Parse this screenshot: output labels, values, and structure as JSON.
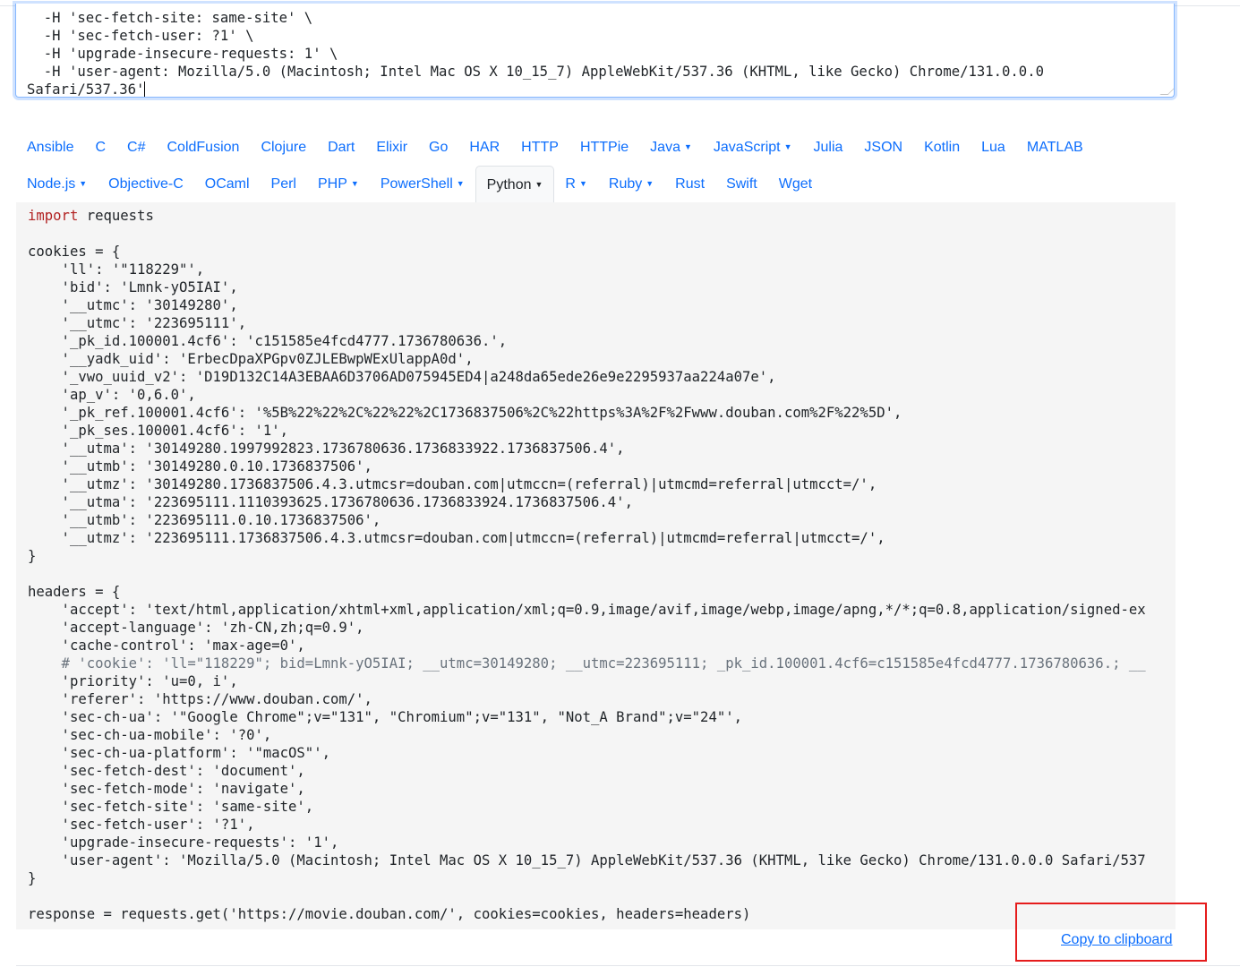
{
  "curl_input": {
    "lines": [
      "  -H 'sec-fetch-site: same-site' \\",
      "  -H 'sec-fetch-user: ?1' \\",
      "  -H 'upgrade-insecure-requests: 1' \\",
      "  -H 'user-agent: Mozilla/5.0 (Macintosh; Intel Mac OS X 10_15_7) AppleWebKit/537.36 (KHTML, like Gecko) Chrome/131.0.0.0",
      "Safari/537.36'"
    ]
  },
  "language_tabs": {
    "row1": [
      {
        "label": "Ansible"
      },
      {
        "label": "C"
      },
      {
        "label": "C#"
      },
      {
        "label": "ColdFusion"
      },
      {
        "label": "Clojure"
      },
      {
        "label": "Dart"
      },
      {
        "label": "Elixir"
      },
      {
        "label": "Go"
      },
      {
        "label": "HAR"
      },
      {
        "label": "HTTP"
      },
      {
        "label": "HTTPie"
      },
      {
        "label": "Java",
        "dropdown": true
      },
      {
        "label": "JavaScript",
        "dropdown": true
      },
      {
        "label": "Julia"
      },
      {
        "label": "JSON"
      },
      {
        "label": "Kotlin"
      },
      {
        "label": "Lua"
      },
      {
        "label": "MATLAB"
      }
    ],
    "row2": [
      {
        "label": "Node.js",
        "dropdown": true
      },
      {
        "label": "Objective-C"
      },
      {
        "label": "OCaml"
      },
      {
        "label": "Perl"
      },
      {
        "label": "PHP",
        "dropdown": true
      },
      {
        "label": "PowerShell",
        "dropdown": true
      },
      {
        "label": "Python",
        "dropdown": true,
        "active": true
      },
      {
        "label": "R",
        "dropdown": true
      },
      {
        "label": "Ruby",
        "dropdown": true
      },
      {
        "label": "Rust"
      },
      {
        "label": "Swift"
      },
      {
        "label": "Wget"
      }
    ]
  },
  "code_output": {
    "lines": [
      {
        "kw": "import",
        "text": " requests"
      },
      {
        "text": ""
      },
      {
        "text": "cookies = {"
      },
      {
        "text": "    'll': '\"118229\"',"
      },
      {
        "text": "    'bid': 'Lmnk-yO5IAI',"
      },
      {
        "text": "    '__utmc': '30149280',"
      },
      {
        "text": "    '__utmc': '223695111',"
      },
      {
        "text": "    '_pk_id.100001.4cf6': 'c151585e4fcd4777.1736780636.',"
      },
      {
        "text": "    '__yadk_uid': 'ErbecDpaXPGpv0ZJLEBwpWExUlappA0d',"
      },
      {
        "text": "    '_vwo_uuid_v2': 'D19D132C14A3EBAA6D3706AD075945ED4|a248da65ede26e9e2295937aa224a07e',"
      },
      {
        "text": "    'ap_v': '0,6.0',"
      },
      {
        "text": "    '_pk_ref.100001.4cf6': '%5B%22%22%2C%22%22%2C1736837506%2C%22https%3A%2F%2Fwww.douban.com%2F%22%5D',"
      },
      {
        "text": "    '_pk_ses.100001.4cf6': '1',"
      },
      {
        "text": "    '__utma': '30149280.1997992823.1736780636.1736833922.1736837506.4',"
      },
      {
        "text": "    '__utmb': '30149280.0.10.1736837506',"
      },
      {
        "text": "    '__utmz': '30149280.1736837506.4.3.utmcsr=douban.com|utmccn=(referral)|utmcmd=referral|utmcct=/',"
      },
      {
        "text": "    '__utma': '223695111.1110393625.1736780636.1736833924.1736837506.4',"
      },
      {
        "text": "    '__utmb': '223695111.0.10.1736837506',"
      },
      {
        "text": "    '__utmz': '223695111.1736837506.4.3.utmcsr=douban.com|utmccn=(referral)|utmcmd=referral|utmcct=/',"
      },
      {
        "text": "}"
      },
      {
        "text": ""
      },
      {
        "text": "headers = {"
      },
      {
        "text": "    'accept': 'text/html,application/xhtml+xml,application/xml;q=0.9,image/avif,image/webp,image/apng,*/*;q=0.8,application/signed-ex"
      },
      {
        "text": "    'accept-language': 'zh-CN,zh;q=0.9',"
      },
      {
        "text": "    'cache-control': 'max-age=0',"
      },
      {
        "comment": true,
        "text": "    # 'cookie': 'll=\"118229\"; bid=Lmnk-yO5IAI; __utmc=30149280; __utmc=223695111; _pk_id.100001.4cf6=c151585e4fcd4777.1736780636.; __"
      },
      {
        "text": "    'priority': 'u=0, i',"
      },
      {
        "text": "    'referer': 'https://www.douban.com/',"
      },
      {
        "text": "    'sec-ch-ua': '\"Google Chrome\";v=\"131\", \"Chromium\";v=\"131\", \"Not_A Brand\";v=\"24\"',"
      },
      {
        "text": "    'sec-ch-ua-mobile': '?0',"
      },
      {
        "text": "    'sec-ch-ua-platform': '\"macOS\"',"
      },
      {
        "text": "    'sec-fetch-dest': 'document',"
      },
      {
        "text": "    'sec-fetch-mode': 'navigate',"
      },
      {
        "text": "    'sec-fetch-site': 'same-site',"
      },
      {
        "text": "    'sec-fetch-user': '?1',"
      },
      {
        "text": "    'upgrade-insecure-requests': '1',"
      },
      {
        "text": "    'user-agent': 'Mozilla/5.0 (Macintosh; Intel Mac OS X 10_15_7) AppleWebKit/537.36 (KHTML, like Gecko) Chrome/131.0.0.0 Safari/537"
      },
      {
        "text": "}"
      },
      {
        "text": ""
      },
      {
        "text": "response = requests.get('https://movie.douban.com/', cookies=cookies, headers=headers)"
      }
    ]
  },
  "copy_link": "Copy to clipboard",
  "colors": {
    "link": "#0d6efd",
    "keyword": "#b22222",
    "comment": "#6a737d",
    "highlight_box": "#e51c1c"
  }
}
